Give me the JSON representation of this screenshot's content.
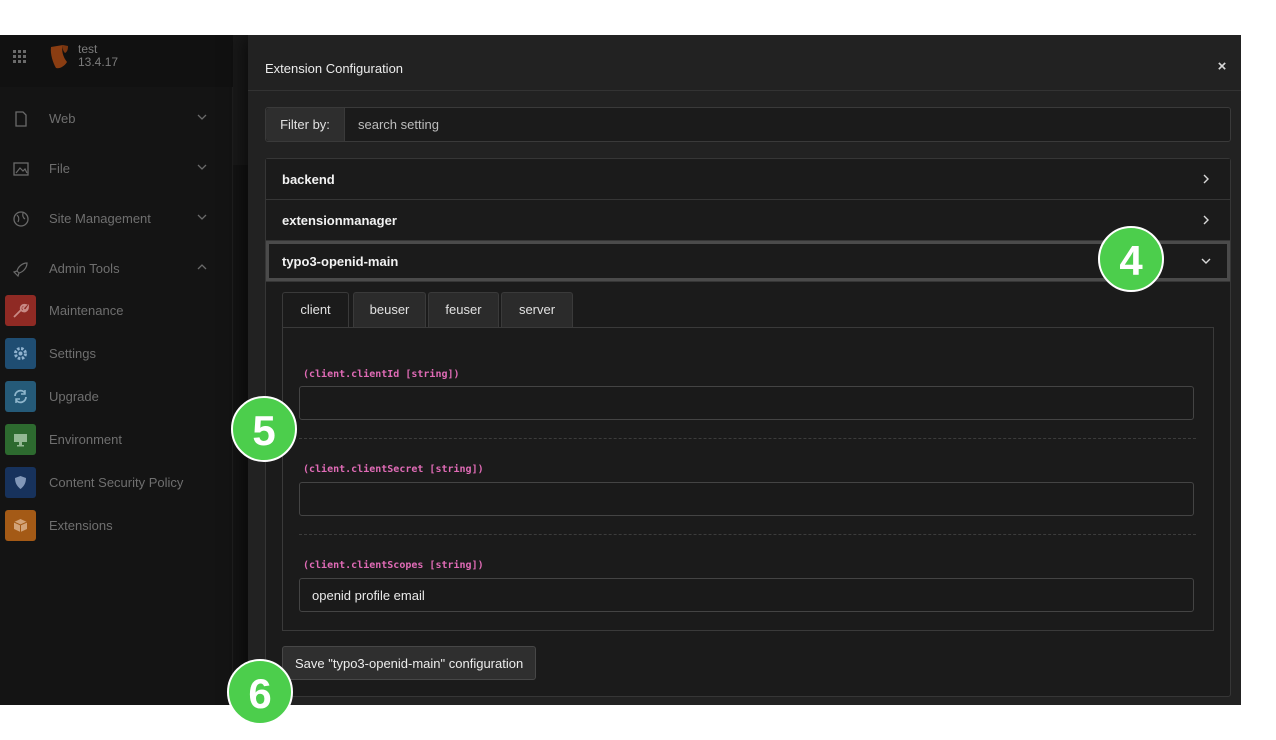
{
  "site": {
    "name": "test",
    "version": "13.4.17"
  },
  "sidebar": {
    "groups": [
      {
        "label": "Web",
        "icon": "page-icon"
      },
      {
        "label": "File",
        "icon": "image-icon"
      },
      {
        "label": "Site Management",
        "icon": "globe-icon"
      },
      {
        "label": "Admin Tools",
        "icon": "rocket-icon"
      }
    ],
    "modules": [
      {
        "label": "Maintenance",
        "icon": "wrench-icon",
        "color": "#8f2a24"
      },
      {
        "label": "Settings",
        "icon": "gear-icon",
        "color": "#1f4d72"
      },
      {
        "label": "Upgrade",
        "icon": "refresh-icon",
        "color": "#255a78"
      },
      {
        "label": "Environment",
        "icon": "monitor-icon",
        "color": "#2d6a2f"
      },
      {
        "label": "Content Security Policy",
        "icon": "shield-icon",
        "color": "#17325c"
      },
      {
        "label": "Extensions",
        "icon": "box-icon",
        "color": "#a45a16"
      }
    ]
  },
  "modal": {
    "title": "Extension Configuration",
    "close": "×",
    "filter": {
      "label": "Filter by:",
      "placeholder": "search setting"
    },
    "sections": [
      {
        "title": "backend",
        "expanded": false
      },
      {
        "title": "extensionmanager",
        "expanded": false
      },
      {
        "title": "typo3-openid-main",
        "expanded": true
      }
    ],
    "tabs": [
      "client",
      "beuser",
      "feuser",
      "server"
    ],
    "active_tab": "client",
    "fields": [
      {
        "label": "(client.clientId [string])",
        "value": ""
      },
      {
        "label": "(client.clientSecret [string])",
        "value": ""
      },
      {
        "label": "(client.clientScopes [string])",
        "value": "openid profile email"
      }
    ],
    "save_label": "Save \"typo3-openid-main\" configuration"
  },
  "badges": [
    "4",
    "5",
    "6"
  ],
  "colors": {
    "badge": "#4cce4c",
    "field_label": "#e06bb6"
  }
}
